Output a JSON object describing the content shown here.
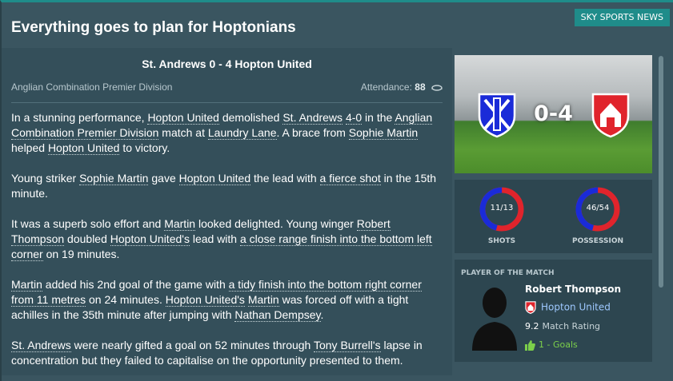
{
  "header": {
    "title": "Everything goes to plan for Hoptonians",
    "source_badge": "SKY SPORTS NEWS"
  },
  "article": {
    "headline": "St. Andrews 0 - 4 Hopton United",
    "competition": "Anglian Combination Premier Division",
    "attendance_label": "Attendance:",
    "attendance_value": "88",
    "paragraphs": [
      "In a stunning performance, Hopton United demolished St. Andrews 4-0 in the Anglian Combination Premier Division match at Laundry Lane. A brace from Sophie Martin helped Hopton United to victory.",
      "Young striker Sophie Martin gave Hopton United the lead with a fierce shot in the 15th minute.",
      "It was a superb solo effort and Martin looked delighted. Young winger Robert Thompson doubled Hopton United's lead with a close range finish into the bottom left corner on 19 minutes.",
      "Martin added his 2nd goal of the game with a tidy finish into the bottom right corner from 11 metres on 24 minutes. Hopton United's Martin was forced off with a tight achilles in the 35th minute after jumping with Nathan Dempsey.",
      "St. Andrews were nearly gifted a goal on 52 minutes through Tony Burrell's lapse in concentration but they failed to capitalise on the opportunity presented to them."
    ]
  },
  "match": {
    "score": "0-4",
    "home_badge_icon": "st-andrews-crest-icon",
    "away_badge_icon": "hopton-united-crest-icon",
    "stats": [
      {
        "label": "SHOTS",
        "value": "11/13",
        "home_fraction": 0.458
      },
      {
        "label": "POSSESSION",
        "value": "46/54",
        "home_fraction": 0.46
      }
    ],
    "colors": {
      "home": "#1a2bd8",
      "away": "#e0242c"
    }
  },
  "potm": {
    "heading": "PLAYER OF THE MATCH",
    "name": "Robert Thompson",
    "club": "Hopton United",
    "rating": "9.2",
    "rating_label": "Match Rating",
    "goals": "1 - Goals"
  }
}
